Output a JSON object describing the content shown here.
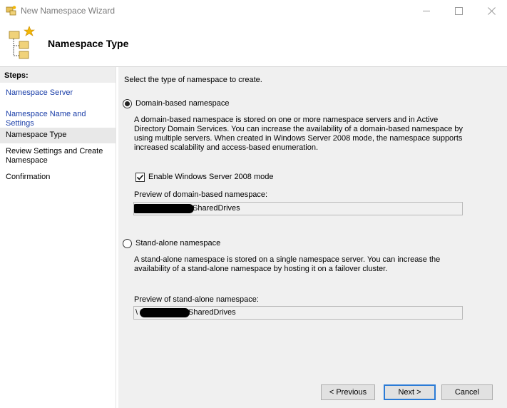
{
  "window": {
    "title": "New Namespace Wizard"
  },
  "header": {
    "title": "Namespace Type"
  },
  "steps": {
    "heading": "Steps:",
    "items": [
      {
        "label": "Namespace Server",
        "state": "link"
      },
      {
        "label": "Namespace Name and Settings",
        "state": "link"
      },
      {
        "label": "Namespace Type",
        "state": "current"
      },
      {
        "label": "Review Settings and Create Namespace",
        "state": "pending"
      },
      {
        "label": "Confirmation",
        "state": "pending"
      }
    ]
  },
  "main": {
    "instruction": "Select the type of namespace to create.",
    "domain_option": {
      "label": "Domain-based namespace",
      "selected": true,
      "description": "A domain-based namespace is stored on one or more namespace servers and in Active Directory Domain Services. You can increase the availability of a domain-based namespace by using multiple servers. When created in Windows Server 2008 mode, the namespace supports increased scalability and access-based enumeration.",
      "checkbox_label": "Enable Windows Server 2008 mode",
      "checkbox_checked": true,
      "preview_label": "Preview of domain-based namespace:",
      "preview_value": "SharedDrives"
    },
    "standalone_option": {
      "label": "Stand-alone namespace",
      "selected": false,
      "description": "A stand-alone namespace is stored on a single namespace server. You can increase the availability of a stand-alone namespace by hosting it on a failover cluster.",
      "preview_label": "Preview of stand-alone namespace:",
      "preview_prefix": "\\",
      "preview_value": "SharedDrives"
    }
  },
  "buttons": {
    "previous": "< Previous",
    "next": "Next >",
    "cancel": "Cancel"
  },
  "colors": {
    "link": "#1a3ea8",
    "content_bg": "#f0f0f0",
    "default_button_border": "#2b7bd6"
  }
}
